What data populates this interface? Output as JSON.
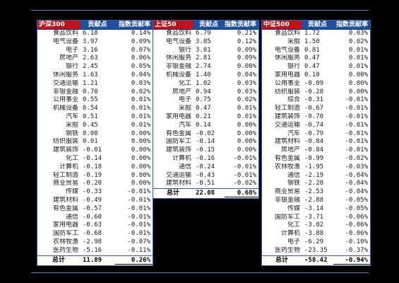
{
  "panels": [
    {
      "headers": [
        "沪深300",
        "贡献点",
        "指数贡献率"
      ],
      "rows": [
        [
          "食品饮料",
          "6.18",
          "0.14%"
        ],
        [
          "电气设备",
          "3.97",
          "0.09%"
        ],
        [
          "电子",
          "3.16",
          "0.07%"
        ],
        [
          "房地产",
          "2.63",
          "0.06%"
        ],
        [
          "银行",
          "2.45",
          "0.05%"
        ],
        [
          "休闲服务",
          "1.63",
          "0.04%"
        ],
        [
          "交通运输",
          "1.21",
          "0.03%"
        ],
        [
          "非银金融",
          "0.70",
          "0.02%"
        ],
        [
          "公用事业",
          "0.55",
          "0.01%"
        ],
        [
          "机械设备",
          "0.54",
          "0.01%"
        ],
        [
          "汽车",
          "0.51",
          "0.01%"
        ],
        [
          "采掘",
          "0.45",
          "0.01%"
        ],
        [
          "钢铁",
          "0.08",
          "0.00%"
        ],
        [
          "纺织服装",
          "0.01",
          "0.00%"
        ],
        [
          "建筑装饰",
          "-0.01",
          "0.00%"
        ],
        [
          "化工",
          "-0.14",
          "0.00%"
        ],
        [
          "计算机",
          "-0.18",
          "0.00%"
        ],
        [
          "轻工制造",
          "-0.19",
          "0.00%"
        ],
        [
          "商业贸易",
          "-0.20",
          "0.00%"
        ],
        [
          "传媒",
          "-0.33",
          "-0.01%"
        ],
        [
          "建筑材料",
          "-0.49",
          "-0.01%"
        ],
        [
          "有色金属",
          "-0.57",
          "-0.01%"
        ],
        [
          "通信",
          "-0.60",
          "-0.01%"
        ],
        [
          "家用电器",
          "-0.63",
          "-0.01%"
        ],
        [
          "国防军工",
          "-0.68",
          "-0.01%"
        ],
        [
          "农林牧渔",
          "-2.98",
          "-0.07%"
        ],
        [
          "医药生物",
          "-5.16",
          "-0.11%"
        ]
      ],
      "total": [
        "总计",
        "11.89",
        "0.26%"
      ]
    },
    {
      "headers": [
        "上证50",
        "贡献点",
        "指数贡献率"
      ],
      "rows": [
        [
          "食品饮料",
          "6.79",
          "0.21%"
        ],
        [
          "电气设备",
          "3.85",
          "0.12%"
        ],
        [
          "银行",
          "3.01",
          "0.09%"
        ],
        [
          "休闲服务",
          "2.81",
          "0.09%"
        ],
        [
          "非银金融",
          "2.74",
          "0.08%"
        ],
        [
          "机械设备",
          "1.40",
          "0.04%"
        ],
        [
          "化工",
          "1.02",
          "0.03%"
        ],
        [
          "房地产",
          "0.94",
          "0.03%"
        ],
        [
          "电子",
          "0.75",
          "0.02%"
        ],
        [
          "采掘",
          "0.47",
          "0.01%"
        ],
        [
          "家用电器",
          "0.21",
          "0.01%"
        ],
        [
          "汽车",
          "0.14",
          "0.00%"
        ],
        [
          "有色金属",
          "-0.02",
          "0.00%"
        ],
        [
          "国防军工",
          "-0.14",
          "0.00%"
        ],
        [
          "建筑装饰",
          "-0.15",
          "0.00%"
        ],
        [
          "计算机",
          "-0.16",
          "-0.01%"
        ],
        [
          "通信",
          "-0.24",
          "-0.01%"
        ],
        [
          "交通运输",
          "-0.43",
          "-0.01%"
        ],
        [
          "建筑材料",
          "-0.51",
          "-0.02%"
        ]
      ],
      "total": [
        "总计",
        "22.08",
        "0.68%"
      ]
    },
    {
      "headers": [
        "中证500",
        "贡献点",
        "指数贡献率"
      ],
      "rows": [
        [
          "食品饮料",
          "1.72",
          "0.03%"
        ],
        [
          "采掘",
          "1.50",
          "0.02%"
        ],
        [
          "电气设备",
          "0.81",
          "0.01%"
        ],
        [
          "休闲服务",
          "0.47",
          "0.01%"
        ],
        [
          "银行",
          "0.47",
          "0.01%"
        ],
        [
          "家用电器",
          "0.10",
          "0.00%"
        ],
        [
          "公用事业",
          "-0.09",
          "0.00%"
        ],
        [
          "纺织服装",
          "-0.28",
          "0.00%"
        ],
        [
          "综合",
          "-0.31",
          "-0.01%"
        ],
        [
          "轻工制造",
          "-0.67",
          "-0.01%"
        ],
        [
          "建筑装饰",
          "-0.70",
          "-0.01%"
        ],
        [
          "交通运输",
          "-0.74",
          "-0.01%"
        ],
        [
          "汽车",
          "-0.79",
          "-0.01%"
        ],
        [
          "建筑材料",
          "-0.84",
          "-0.01%"
        ],
        [
          "房地产",
          "-0.84",
          "-0.01%"
        ],
        [
          "有色金属",
          "-0.99",
          "-0.02%"
        ],
        [
          "农林牧渔",
          "-1.95",
          "-0.03%"
        ],
        [
          "通信",
          "-2.19",
          "-0.04%"
        ],
        [
          "钢铁",
          "-2.28",
          "-0.04%"
        ],
        [
          "商业贸易",
          "-2.53",
          "-0.04%"
        ],
        [
          "非银金融",
          "-2.88",
          "-0.05%"
        ],
        [
          "传媒",
          "-3.14",
          "-0.05%"
        ],
        [
          "国防军工",
          "-3.71",
          "-0.06%"
        ],
        [
          "化工",
          "-3.82",
          "-0.06%"
        ],
        [
          "计算机",
          "-3.88",
          "-0.06%"
        ],
        [
          "电子",
          "-6.29",
          "-0.10%"
        ],
        [
          "医药生物",
          "-23.35",
          "-0.37%"
        ]
      ],
      "total": [
        "总计",
        "-58.42",
        "-0.94%"
      ]
    }
  ],
  "colors": {
    "background": "#000000",
    "header_bg": "#1f4f9f",
    "header_index_bg": "#c0121a",
    "header_text": "#ffffff",
    "body_bg": "#ffffff",
    "body_text": "#1a1a1a"
  }
}
